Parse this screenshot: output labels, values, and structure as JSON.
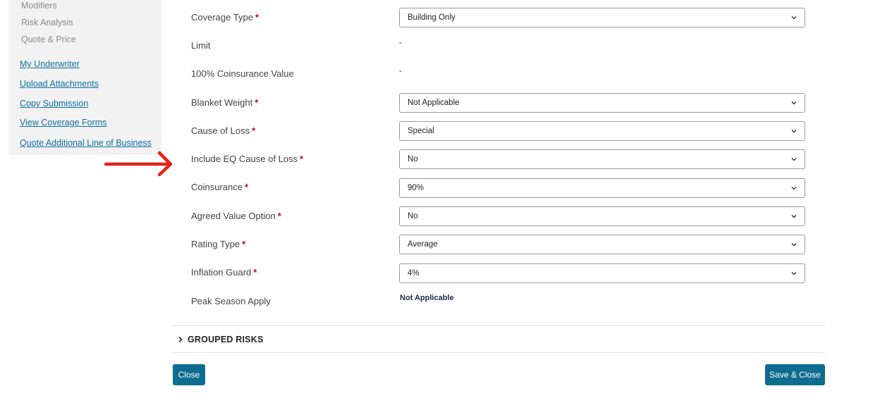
{
  "sidebar": {
    "sub_items": [
      {
        "label": "Modifiers"
      },
      {
        "label": "Risk Analysis"
      },
      {
        "label": "Quote & Price"
      }
    ],
    "links": [
      {
        "label": "My Underwriter"
      },
      {
        "label": "Upload Attachments"
      },
      {
        "label": "Copy Submission"
      },
      {
        "label": "View Coverage Forms"
      },
      {
        "label": "Quote Additional Line of Business"
      }
    ]
  },
  "annotation": {
    "arrow_color": "#e8201a"
  },
  "form": {
    "required_marker": "*",
    "fields": [
      {
        "label": "Coverage Type",
        "value": "Building Only"
      },
      {
        "label": "Limit",
        "value": "-"
      },
      {
        "label": "100% Coinsurance Value",
        "value": "-"
      },
      {
        "label": "Blanket Weight",
        "value": "Not Applicable"
      },
      {
        "label": "Cause of Loss",
        "value": "Special"
      },
      {
        "label": "Include EQ Cause of Loss",
        "value": "No"
      },
      {
        "label": "Coinsurance",
        "value": "90%"
      },
      {
        "label": "Agreed Value Option",
        "value": "No"
      },
      {
        "label": "Rating Type",
        "value": "Average"
      },
      {
        "label": "Inflation Guard",
        "value": "4%"
      },
      {
        "label": "Peak Season Apply",
        "value": "Not Applicable"
      }
    ]
  },
  "grouped_risks": {
    "title": "GROUPED RISKS"
  },
  "footer": {
    "close_label": "Close",
    "save_close_label": "Save & Close"
  },
  "colors": {
    "link": "#106fa0",
    "required": "#d0021b",
    "button": "#0e6d8e"
  }
}
